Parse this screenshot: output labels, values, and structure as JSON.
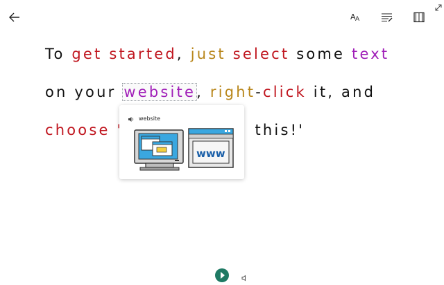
{
  "toolbar": {
    "back_icon": "arrow-left-icon",
    "text_options_icon": "text-size-icon",
    "grammar_icon": "grammar-options-icon",
    "reading_prefs_icon": "book-icon",
    "expand_icon": "expand-icon"
  },
  "colors": {
    "red": "#c0161f",
    "gold": "#b8861a",
    "purple": "#a01eb8",
    "black": "#111111",
    "play": "#1f7a64"
  },
  "reading": {
    "line1": [
      {
        "text": "To ",
        "color": "black"
      },
      {
        "text": "get started",
        "color": "red"
      },
      {
        "text": ", ",
        "color": "black"
      },
      {
        "text": "just",
        "color": "gold"
      },
      {
        "text": " ",
        "color": "black"
      },
      {
        "text": "select",
        "color": "red"
      },
      {
        "text": " some ",
        "color": "black"
      },
      {
        "text": "text",
        "color": "purple"
      }
    ],
    "line2": [
      {
        "text": "on your ",
        "color": "black"
      },
      {
        "text": "website",
        "color": "purple",
        "highlight": true
      },
      {
        "text": ", ",
        "color": "black"
      },
      {
        "text": "right",
        "color": "gold"
      },
      {
        "text": "-",
        "color": "black"
      },
      {
        "text": "click",
        "color": "red"
      },
      {
        "text": " it, and",
        "color": "black"
      }
    ],
    "line3": [
      {
        "text": "choose '",
        "color": "red_first"
      },
      {
        "text": "this!'",
        "color": "black"
      }
    ]
  },
  "popup": {
    "speaker_icon": "speaker-icon",
    "word": "website",
    "picture_1": "computer-window-icon",
    "picture_2": "browser-www-icon",
    "www_label": "www"
  },
  "bottom": {
    "play_icon": "play-icon",
    "voice_icon": "voice-settings-icon"
  }
}
